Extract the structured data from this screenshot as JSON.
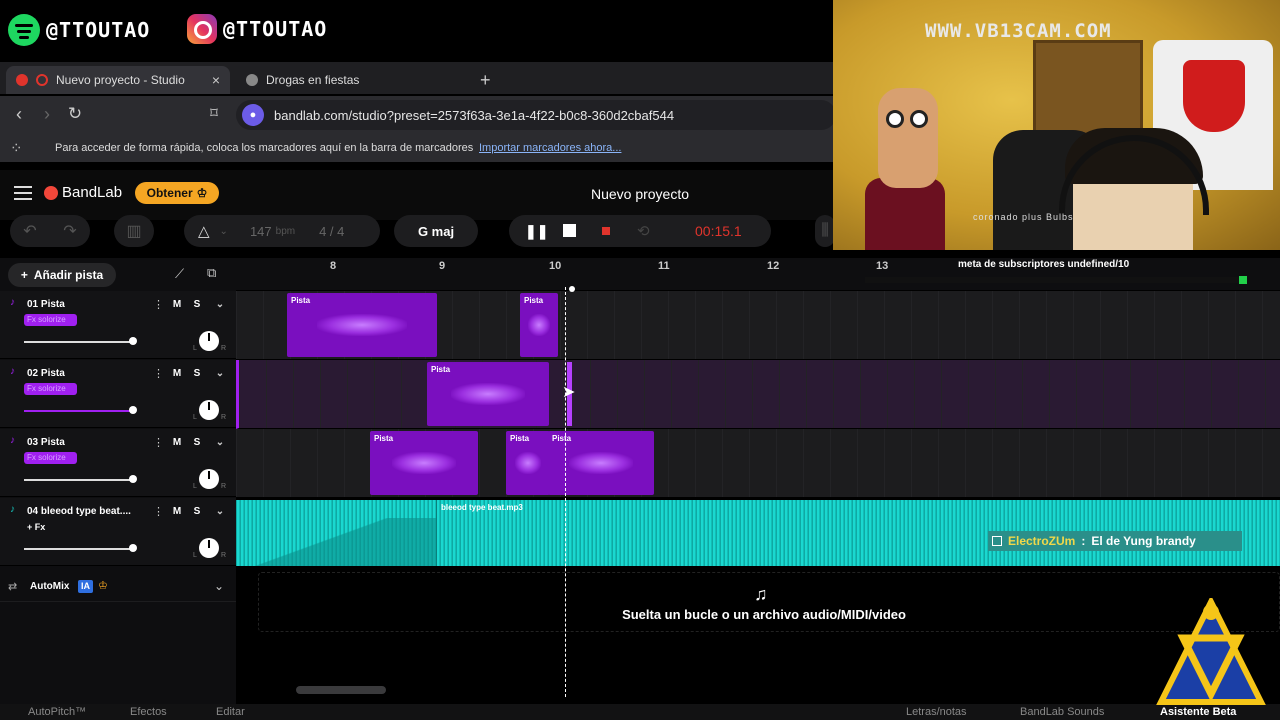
{
  "overlay": {
    "spotify_handle": "@TTOUTAO",
    "instagram_handle": "@TTOUTAO",
    "cam_watermark": "WWW.VB13CAM.COM",
    "cam_caption": "coronado plus Bulbs",
    "meta_text": "meta de subscriptores undefined/10",
    "chat_user": "ElectroZUm",
    "chat_sep": ":",
    "chat_message": "El de Yung brandy"
  },
  "browser": {
    "tabs": [
      {
        "label": "Nuevo proyecto - Studio",
        "active": true
      },
      {
        "label": "Drogas en fiestas",
        "active": false
      }
    ],
    "url": "bandlab.com/studio?preset=2573f63a-3e1a-4f22-b0c8-360d2cbaf544",
    "bookmarks_hint": "Para acceder de forma rápida, coloca los marcadores aquí en la barra de marcadores",
    "bookmarks_link": "Importar marcadores ahora..."
  },
  "app": {
    "brand": "BandLab",
    "upgrade_label": "Obtener",
    "project_title": "Nuevo proyecto",
    "bpm_value": "147",
    "bpm_unit": "bpm",
    "time_signature": "4 / 4",
    "key": "G maj",
    "time": "00:15.1",
    "add_track_label": "Añadir pista",
    "automix_label": "AutoMix",
    "automix_badge": "IA",
    "drop_hint": "Suelta un bucle o un archivo audio/MIDI/video"
  },
  "ruler": [
    "8",
    "9",
    "10",
    "11",
    "12",
    "13"
  ],
  "tracks": [
    {
      "name": "01  Pista",
      "fx": "Fx solorize",
      "mute": "M",
      "solo": "S"
    },
    {
      "name": "02  Pista",
      "fx": "Fx solorize",
      "mute": "M",
      "solo": "S"
    },
    {
      "name": "03  Pista",
      "fx": "Fx solorize",
      "mute": "M",
      "solo": "S"
    },
    {
      "name": "04  bleeod type beat....",
      "fx": "+ Fx",
      "mute": "M",
      "solo": "S"
    }
  ],
  "clips": {
    "label": "Pista",
    "beat_label": "bleeod type beat.mp3"
  },
  "bottom": {
    "items": [
      "AutoPitch™",
      "Efectos",
      "Editar",
      "Letras/notas",
      "BandLab Sounds",
      "Asistente Beta"
    ]
  },
  "colors": {
    "accent_purple": "#a020f0",
    "clip_purple": "#7a0fbf",
    "beat_teal": "#16c7c0",
    "record_red": "#e0342c",
    "upgrade_orange": "#f5a623"
  }
}
